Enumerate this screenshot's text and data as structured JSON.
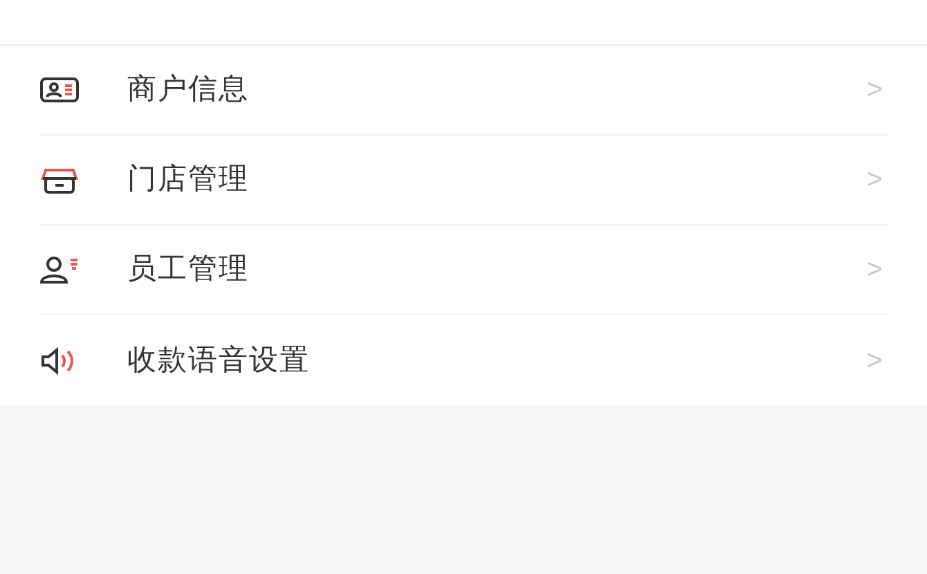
{
  "menu_items": [
    {
      "label": "商户信息",
      "chevron": ">"
    },
    {
      "label": "门店管理",
      "chevron": ">"
    },
    {
      "label": "员工管理",
      "chevron": ">"
    },
    {
      "label": "收款语音设置",
      "chevron": ">"
    }
  ]
}
